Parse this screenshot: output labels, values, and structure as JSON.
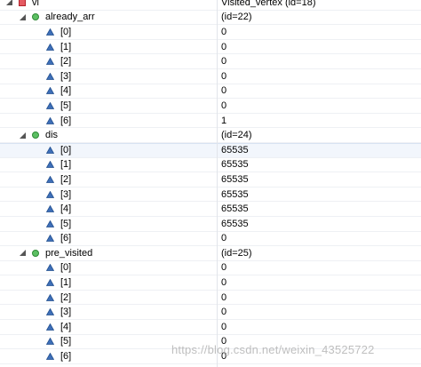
{
  "variables_view": {
    "root": {
      "name": "vi",
      "value": "Visited_vertex  (id=18)",
      "icon": "private-field-red-square-icon",
      "expander": "expanded-triangle-icon"
    },
    "groups": [
      {
        "name": "already_arr",
        "value": "(id=22)",
        "icon": "public-field-green-circle-icon",
        "expander": "expanded-triangle-icon",
        "items": [
          {
            "name": "[0]",
            "value": "0"
          },
          {
            "name": "[1]",
            "value": "0"
          },
          {
            "name": "[2]",
            "value": "0"
          },
          {
            "name": "[3]",
            "value": "0"
          },
          {
            "name": "[4]",
            "value": "0"
          },
          {
            "name": "[5]",
            "value": "0"
          },
          {
            "name": "[6]",
            "value": "1"
          }
        ]
      },
      {
        "name": "dis",
        "value": "(id=24)",
        "icon": "public-field-green-circle-icon",
        "expander": "expanded-triangle-icon",
        "items": [
          {
            "name": "[0]",
            "value": "65535"
          },
          {
            "name": "[1]",
            "value": "65535"
          },
          {
            "name": "[2]",
            "value": "65535"
          },
          {
            "name": "[3]",
            "value": "65535"
          },
          {
            "name": "[4]",
            "value": "65535"
          },
          {
            "name": "[5]",
            "value": "65535"
          },
          {
            "name": "[6]",
            "value": "0"
          }
        ]
      },
      {
        "name": "pre_visited",
        "value": "(id=25)",
        "icon": "public-field-green-circle-icon",
        "expander": "expanded-triangle-icon",
        "items": [
          {
            "name": "[0]",
            "value": "0"
          },
          {
            "name": "[1]",
            "value": "0"
          },
          {
            "name": "[2]",
            "value": "0"
          },
          {
            "name": "[3]",
            "value": "0"
          },
          {
            "name": "[4]",
            "value": "0"
          },
          {
            "name": "[5]",
            "value": "0"
          },
          {
            "name": "[6]",
            "value": "0"
          }
        ]
      }
    ],
    "element_icon": "array-element-blue-triangle-icon",
    "selected_row": "dis.[0]"
  },
  "watermark": {
    "text": "https://blog.csdn.net/weixin_43525722"
  },
  "colors": {
    "private_field": "#d9303a",
    "public_field": "#3fa64a",
    "array_element": "#2f5fa8",
    "expander": "#555555",
    "selection_background": "#f2f6fc"
  }
}
